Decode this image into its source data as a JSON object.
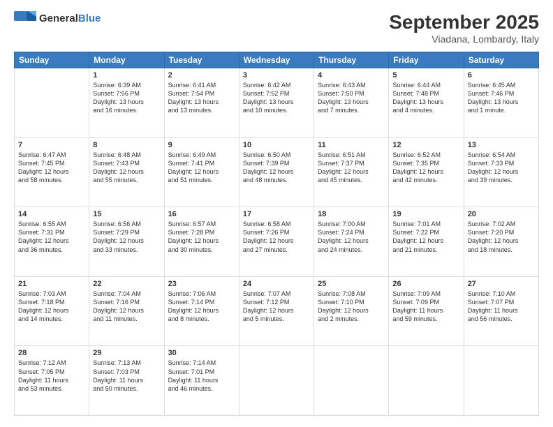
{
  "header": {
    "logo_line1": "General",
    "logo_line2": "Blue",
    "title": "September 2025",
    "subtitle": "Viadana, Lombardy, Italy"
  },
  "weekdays": [
    "Sunday",
    "Monday",
    "Tuesday",
    "Wednesday",
    "Thursday",
    "Friday",
    "Saturday"
  ],
  "weeks": [
    [
      {
        "day": "",
        "info": ""
      },
      {
        "day": "1",
        "info": "Sunrise: 6:39 AM\nSunset: 7:56 PM\nDaylight: 13 hours\nand 16 minutes."
      },
      {
        "day": "2",
        "info": "Sunrise: 6:41 AM\nSunset: 7:54 PM\nDaylight: 13 hours\nand 13 minutes."
      },
      {
        "day": "3",
        "info": "Sunrise: 6:42 AM\nSunset: 7:52 PM\nDaylight: 13 hours\nand 10 minutes."
      },
      {
        "day": "4",
        "info": "Sunrise: 6:43 AM\nSunset: 7:50 PM\nDaylight: 13 hours\nand 7 minutes."
      },
      {
        "day": "5",
        "info": "Sunrise: 6:44 AM\nSunset: 7:48 PM\nDaylight: 13 hours\nand 4 minutes."
      },
      {
        "day": "6",
        "info": "Sunrise: 6:45 AM\nSunset: 7:46 PM\nDaylight: 13 hours\nand 1 minute."
      }
    ],
    [
      {
        "day": "7",
        "info": "Sunrise: 6:47 AM\nSunset: 7:45 PM\nDaylight: 12 hours\nand 58 minutes."
      },
      {
        "day": "8",
        "info": "Sunrise: 6:48 AM\nSunset: 7:43 PM\nDaylight: 12 hours\nand 55 minutes."
      },
      {
        "day": "9",
        "info": "Sunrise: 6:49 AM\nSunset: 7:41 PM\nDaylight: 12 hours\nand 51 minutes."
      },
      {
        "day": "10",
        "info": "Sunrise: 6:50 AM\nSunset: 7:39 PM\nDaylight: 12 hours\nand 48 minutes."
      },
      {
        "day": "11",
        "info": "Sunrise: 6:51 AM\nSunset: 7:37 PM\nDaylight: 12 hours\nand 45 minutes."
      },
      {
        "day": "12",
        "info": "Sunrise: 6:52 AM\nSunset: 7:35 PM\nDaylight: 12 hours\nand 42 minutes."
      },
      {
        "day": "13",
        "info": "Sunrise: 6:54 AM\nSunset: 7:33 PM\nDaylight: 12 hours\nand 39 minutes."
      }
    ],
    [
      {
        "day": "14",
        "info": "Sunrise: 6:55 AM\nSunset: 7:31 PM\nDaylight: 12 hours\nand 36 minutes."
      },
      {
        "day": "15",
        "info": "Sunrise: 6:56 AM\nSunset: 7:29 PM\nDaylight: 12 hours\nand 33 minutes."
      },
      {
        "day": "16",
        "info": "Sunrise: 6:57 AM\nSunset: 7:28 PM\nDaylight: 12 hours\nand 30 minutes."
      },
      {
        "day": "17",
        "info": "Sunrise: 6:58 AM\nSunset: 7:26 PM\nDaylight: 12 hours\nand 27 minutes."
      },
      {
        "day": "18",
        "info": "Sunrise: 7:00 AM\nSunset: 7:24 PM\nDaylight: 12 hours\nand 24 minutes."
      },
      {
        "day": "19",
        "info": "Sunrise: 7:01 AM\nSunset: 7:22 PM\nDaylight: 12 hours\nand 21 minutes."
      },
      {
        "day": "20",
        "info": "Sunrise: 7:02 AM\nSunset: 7:20 PM\nDaylight: 12 hours\nand 18 minutes."
      }
    ],
    [
      {
        "day": "21",
        "info": "Sunrise: 7:03 AM\nSunset: 7:18 PM\nDaylight: 12 hours\nand 14 minutes."
      },
      {
        "day": "22",
        "info": "Sunrise: 7:04 AM\nSunset: 7:16 PM\nDaylight: 12 hours\nand 11 minutes."
      },
      {
        "day": "23",
        "info": "Sunrise: 7:06 AM\nSunset: 7:14 PM\nDaylight: 12 hours\nand 8 minutes."
      },
      {
        "day": "24",
        "info": "Sunrise: 7:07 AM\nSunset: 7:12 PM\nDaylight: 12 hours\nand 5 minutes."
      },
      {
        "day": "25",
        "info": "Sunrise: 7:08 AM\nSunset: 7:10 PM\nDaylight: 12 hours\nand 2 minutes."
      },
      {
        "day": "26",
        "info": "Sunrise: 7:09 AM\nSunset: 7:09 PM\nDaylight: 11 hours\nand 59 minutes."
      },
      {
        "day": "27",
        "info": "Sunrise: 7:10 AM\nSunset: 7:07 PM\nDaylight: 11 hours\nand 56 minutes."
      }
    ],
    [
      {
        "day": "28",
        "info": "Sunrise: 7:12 AM\nSunset: 7:05 PM\nDaylight: 11 hours\nand 53 minutes."
      },
      {
        "day": "29",
        "info": "Sunrise: 7:13 AM\nSunset: 7:03 PM\nDaylight: 11 hours\nand 50 minutes."
      },
      {
        "day": "30",
        "info": "Sunrise: 7:14 AM\nSunset: 7:01 PM\nDaylight: 11 hours\nand 46 minutes."
      },
      {
        "day": "",
        "info": ""
      },
      {
        "day": "",
        "info": ""
      },
      {
        "day": "",
        "info": ""
      },
      {
        "day": "",
        "info": ""
      }
    ]
  ]
}
